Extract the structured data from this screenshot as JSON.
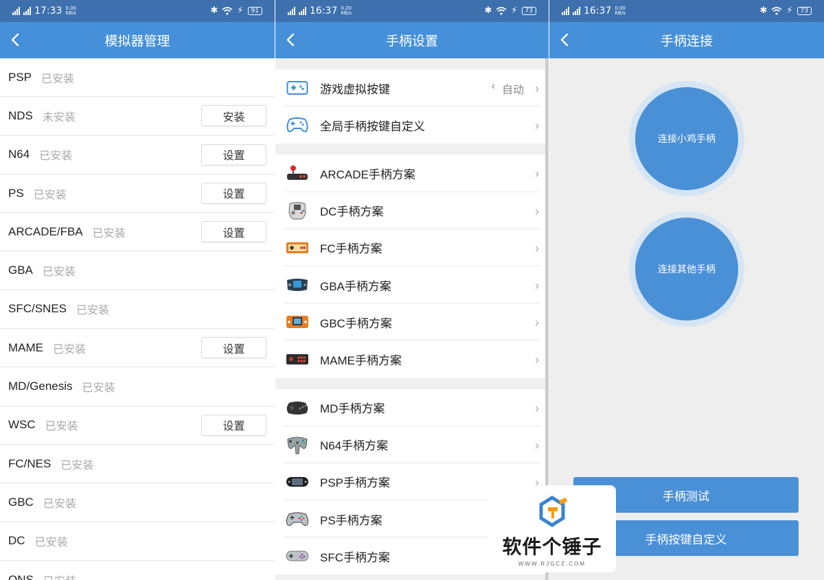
{
  "panel1": {
    "status": {
      "time": "17:33",
      "speed_top": "0.00",
      "speed_bot": "KB/s",
      "net1": "4G",
      "net2": "4G",
      "battery": "91"
    },
    "title": "模拟器管理",
    "rows": [
      {
        "name": "PSP",
        "status": "已安装",
        "button": ""
      },
      {
        "name": "NDS",
        "status": "未安装",
        "button": "安装"
      },
      {
        "name": "N64",
        "status": "已安装",
        "button": "设置"
      },
      {
        "name": "PS",
        "status": "已安装",
        "button": "设置"
      },
      {
        "name": "ARCADE/FBA",
        "status": "已安装",
        "button": "设置"
      },
      {
        "name": "GBA",
        "status": "已安装",
        "button": ""
      },
      {
        "name": "SFC/SNES",
        "status": "已安装",
        "button": ""
      },
      {
        "name": "MAME",
        "status": "已安装",
        "button": "设置"
      },
      {
        "name": "MD/Genesis",
        "status": "已安装",
        "button": ""
      },
      {
        "name": "WSC",
        "status": "已安装",
        "button": "设置"
      },
      {
        "name": "FC/NES",
        "status": "已安装",
        "button": ""
      },
      {
        "name": "GBC",
        "status": "已安装",
        "button": ""
      },
      {
        "name": "DC",
        "status": "已安装",
        "button": ""
      },
      {
        "name": "ONS",
        "status": "已安装",
        "button": ""
      }
    ]
  },
  "panel2": {
    "status": {
      "time": "16:37",
      "speed_top": "0.20",
      "speed_bot": "KB/s",
      "net1": "4G",
      "net2": "4G",
      "battery": "73"
    },
    "title": "手柄设置",
    "groups": [
      [
        {
          "icon": "gamepad-outline-icon",
          "label": "游戏虚拟按键",
          "value": "自动"
        },
        {
          "icon": "gamepad-round-icon",
          "label": "全局手柄按键自定义",
          "value": ""
        }
      ],
      [
        {
          "icon": "arcade-stick-icon",
          "label": "ARCADE手柄方案",
          "value": ""
        },
        {
          "icon": "dc-controller-icon",
          "label": "DC手柄方案",
          "value": ""
        },
        {
          "icon": "fc-controller-icon",
          "label": "FC手柄方案",
          "value": ""
        },
        {
          "icon": "gba-console-icon",
          "label": "GBA手柄方案",
          "value": ""
        },
        {
          "icon": "gbc-console-icon",
          "label": "GBC手柄方案",
          "value": ""
        },
        {
          "icon": "mame-panel-icon",
          "label": "MAME手柄方案",
          "value": ""
        }
      ],
      [
        {
          "icon": "md-controller-icon",
          "label": "MD手柄方案",
          "value": ""
        },
        {
          "icon": "n64-controller-icon",
          "label": "N64手柄方案",
          "value": ""
        },
        {
          "icon": "psp-console-icon",
          "label": "PSP手柄方案",
          "value": ""
        },
        {
          "icon": "ps-controller-icon",
          "label": "PS手柄方案",
          "value": ""
        },
        {
          "icon": "sfc-controller-icon",
          "label": "SFC手柄方案",
          "value": ""
        }
      ]
    ]
  },
  "panel3": {
    "status": {
      "time": "16:37",
      "speed_top": "0.00",
      "speed_bot": "KB/s",
      "net1": "4G",
      "net2": "4G",
      "battery": "73"
    },
    "title": "手柄连接",
    "circle1": "连接小鸡手柄",
    "circle2": "连接其他手柄",
    "btn_test": "手柄测试",
    "btn_custom": "手柄按键自定义"
  },
  "watermark": {
    "text": "软件个锤子",
    "url": "WWW.RJGCZ.COM"
  },
  "colors": {
    "statusbar": "#3d70ad",
    "titlebar": "#4690d9",
    "accent": "#4a90d6"
  }
}
